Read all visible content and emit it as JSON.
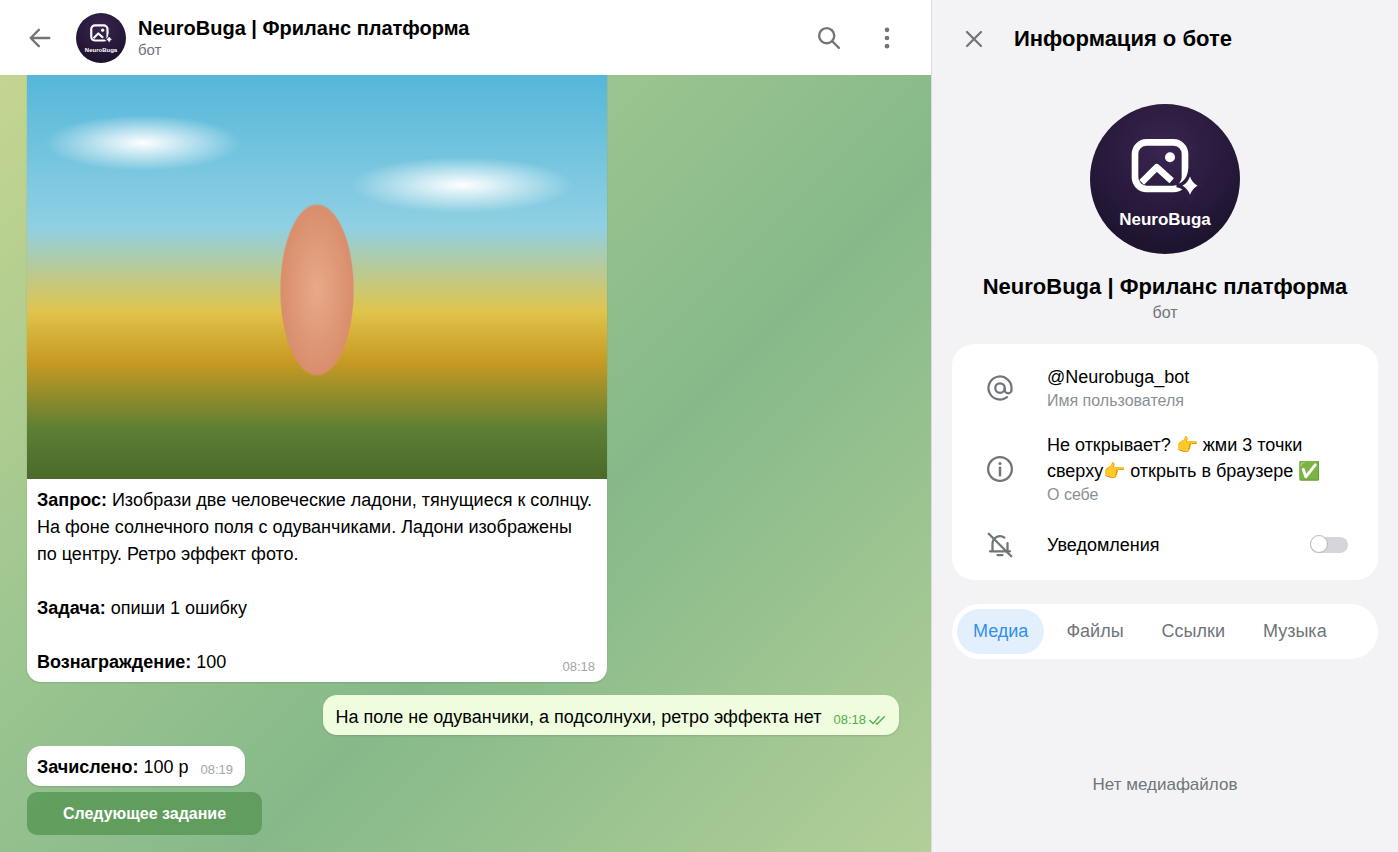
{
  "chat": {
    "title": "NeuroBuga | Фриланс платформа",
    "subtitle": "бот",
    "logo_label": "NeuroBuga"
  },
  "task_message": {
    "fields": [
      {
        "label": "Запрос:",
        "value": "Изобрази две человеческие ладони, тянущиеся к солнцу. На фоне солнечного поля с одуванчиками. Ладони изображены по центру. Ретро эффект фото."
      },
      {
        "label": "Задача:",
        "value": "опиши 1 ошибку"
      },
      {
        "label": "Вознаграждение:",
        "value": "100"
      }
    ],
    "time": "08:18"
  },
  "reply_message": {
    "text": "На поле не одуванчики, а подсолнухи, ретро эффекта нет",
    "time": "08:18",
    "read": true
  },
  "credit_message": {
    "label": "Зачислено:",
    "value": "100 р",
    "time": "08:19"
  },
  "action_button": {
    "label": "Следующее задание"
  },
  "info_panel": {
    "title": "Информация о боте",
    "name": "NeuroBuga | Фриланс платформа",
    "subtitle": "бот",
    "logo_label": "NeuroBuga",
    "rows": [
      {
        "kind": "username",
        "value": "@Neurobuga_bot",
        "caption": "Имя пользователя"
      },
      {
        "kind": "about",
        "value": "Не открывает? 👉 жми 3 точки сверху👉 открыть в браузере ✅",
        "caption": "О себе"
      }
    ],
    "notifications": {
      "label": "Уведомления",
      "on": false
    },
    "tabs": [
      {
        "label": "Медиа",
        "selected": true
      },
      {
        "label": "Файлы",
        "selected": false
      },
      {
        "label": "Ссылки",
        "selected": false
      },
      {
        "label": "Музыка",
        "selected": false
      }
    ],
    "empty_text": "Нет медиафайлов"
  }
}
